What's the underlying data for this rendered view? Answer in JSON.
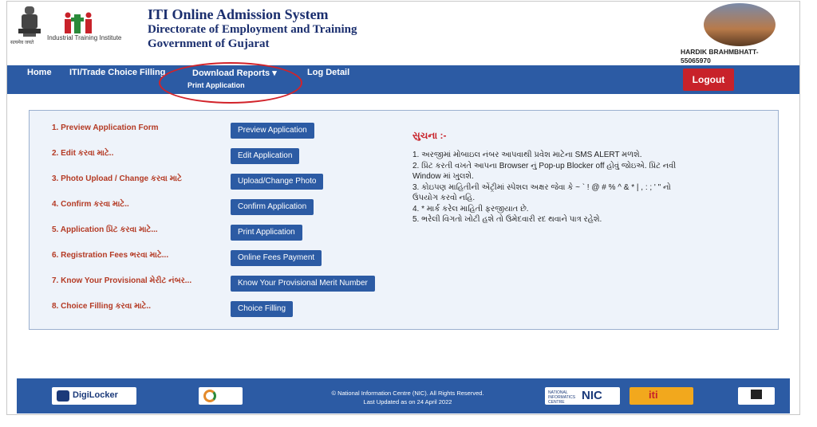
{
  "header": {
    "emblem_caption": "सत्यमेव जयते",
    "iti_logo_text": "iti",
    "iti_caption": "Industrial Training Institute",
    "title_main": "ITI Online Admission System",
    "title_sub1": "Directorate of Employment and Training",
    "title_sub2": "Government of Gujarat",
    "user_name": "HARDIK BRAHMBHATT-",
    "user_id": "55065970"
  },
  "nav": {
    "home": "Home",
    "iti_trade": "ITI/Trade Choice Filling",
    "download_reports": "Download Reports",
    "download_caret": "▾",
    "log_detail": "Log Detail",
    "dropdown_item": "Print Application",
    "logout": "Logout"
  },
  "steps": [
    {
      "label": "1. Preview Application Form",
      "button": "Preview Application"
    },
    {
      "label": "2. Edit કરવા માટે..",
      "button": "Edit Application"
    },
    {
      "label": "3. Photo Upload / Change કરવા માટે",
      "button": "Upload/Change Photo"
    },
    {
      "label": "4. Confirm કરવા માટે..",
      "button": "Confirm Application"
    },
    {
      "label": "5. Application પ્રિંટ કરવા માટે...",
      "button": "Print Application"
    },
    {
      "label": "6. Registration Fees ભરવા માટે...",
      "button": "Online Fees Payment"
    },
    {
      "label": "7. Know Your Provisional મેરીટ નંબર...",
      "button": "Know Your Provisional Merit Number"
    },
    {
      "label": "8. Choice Filling કરવા માટે..",
      "button": "Choice Filling"
    }
  ],
  "notice": {
    "title": "સુચના :-",
    "lines": [
      "1. અરજીમાં મોબાઇલ નંબર આપવાથી પ્રવેશ માટેના SMS ALERT મળશે.",
      "2. પ્રિંટ કરતી વખતે આપના Browser નું Pop-up Blocker off હોવું જોઇએ. પ્રિંટ નવી",
      "Window માં ખુલશે.",
      "3. કોઇપણ માહિતીની એંટ્રીમાં સ્પેશલ અક્ષર જેવા કે ~ ` ! @ # % ^ & * | , : ; ' \" નો",
      "ઉપયોગ કરવો નહિ.",
      "4. * માર્ક કરેલ માહિતી ફરજીયાત છે.",
      "5. ભરેલી વિગતો ખોટી હશે તો ઉમેદવારી રદ થવાને પાત્ર રહેશે."
    ]
  },
  "footer": {
    "digilocker": "DigiLocker",
    "copyright": "© National Information Centre (NIC). All Rights Reserved.",
    "last_updated": "Last Updated as on 24 April 2022",
    "nic": "NIC",
    "nic_small": "NATIONAL INFORMATICS CENTRE",
    "iti": "iti"
  },
  "colors": {
    "nav_blue": "#2c5ba4",
    "logout_red": "#c8222a",
    "step_label": "#b43a24",
    "title_navy": "#1a2e6e",
    "highlight_ring": "#d2232a"
  }
}
